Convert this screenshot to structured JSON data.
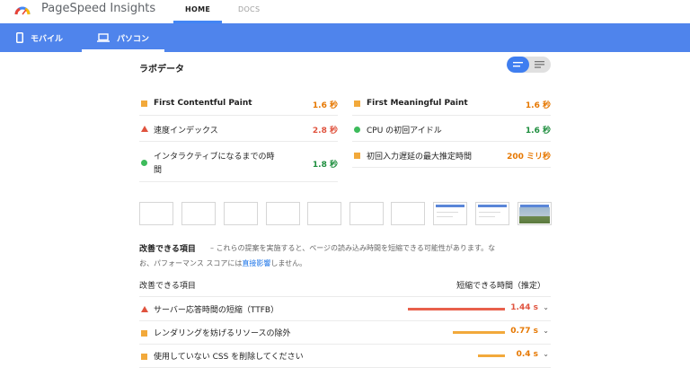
{
  "header": {
    "app_title": "PageSpeed Insights",
    "tabs": [
      {
        "label": "HOME"
      },
      {
        "label": "DOCS"
      }
    ]
  },
  "device_tabs": [
    {
      "label": "モバイル",
      "icon": "phone-icon"
    },
    {
      "label": "パソコン",
      "icon": "laptop-icon"
    }
  ],
  "lab_data": {
    "title": "ラボデータ",
    "metrics_left": [
      {
        "label": "First Contentful Paint",
        "value": "1.6 秒",
        "status": "average",
        "color": "#e67700"
      },
      {
        "label": "速度インデックス",
        "value": "2.8 秒",
        "status": "fail",
        "color": "#e0533e"
      },
      {
        "label": "インタラクティブになるまでの時",
        "label2": "間",
        "value": "1.8 秒",
        "status": "pass",
        "color": "#1e8e3e"
      }
    ],
    "metrics_right": [
      {
        "label": "First Meaningful Paint",
        "value": "1.6 秒",
        "status": "average",
        "color": "#e67700"
      },
      {
        "label": "CPU の初回アイドル",
        "value": "1.6 秒",
        "status": "pass",
        "color": "#1e8e3e"
      },
      {
        "label": "初回入力遅延の最大推定時間",
        "value": "200 ミリ秒",
        "status": "average",
        "color": "#e67700"
      }
    ]
  },
  "opportunities": {
    "title": "改善できる項目",
    "description_1": "– これらの提案を実施すると、ページの読み込み時間を短縮できる可能性があります。な",
    "description_2a": "お、パフォーマンス スコアには",
    "description_link": "直接影響",
    "description_2b": "しません。",
    "col_item": "改善できる項目",
    "col_savings": "短縮できる時間（推定）",
    "rows": [
      {
        "label": "サーバー応答時間の短縮（TTFB）",
        "savings": "1.44 s",
        "savings_s": 1.44,
        "status": "fail",
        "color": "#e0533e"
      },
      {
        "label": "レンダリングを妨げるリソースの除外",
        "savings": "0.77 s",
        "savings_s": 0.77,
        "status": "average",
        "color": "#e67700"
      },
      {
        "label": "使用していない CSS を削除してください",
        "savings": "0.4 s",
        "savings_s": 0.4,
        "status": "average",
        "color": "#e67700"
      }
    ]
  },
  "colors": {
    "accent_blue": "#4f84ec",
    "fail_bar": "#e8604c",
    "average_bar": "#f2a93b"
  }
}
